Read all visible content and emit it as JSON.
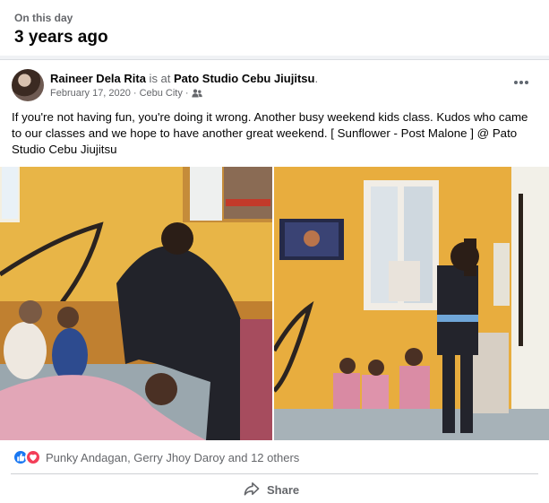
{
  "memory": {
    "label": "On this day",
    "title": "3 years ago"
  },
  "post": {
    "author": "Raineer Dela Rita",
    "is_at": " is at ",
    "place": "Pato Studio Cebu Jiujitsu",
    "place_suffix": ".",
    "date": "February 17, 2020",
    "location": "Cebu City",
    "audience_icon": "friends-icon",
    "more_icon": "more-options-icon",
    "text": "If you're not having fun, you're doing it wrong. Another busy weekend kids class. Kudos who came to our classes and we hope to have another great weekend. [ Sunflower - Post Malone ] @ Pato Studio Cebu Jiujitsu",
    "photos": [
      {
        "name": "photo-kids-class-sparring"
      },
      {
        "name": "photo-kids-class-stretching"
      }
    ]
  },
  "reactions": {
    "icons": [
      "like-icon",
      "love-icon"
    ],
    "summary": "Punky Andagan, Gerry Jhoy Daroy and 12 others"
  },
  "actions": {
    "share_label": "Share",
    "share_icon": "share-icon"
  },
  "colors": {
    "brand_blue": "#1877f2",
    "love_red": "#f33e58",
    "secondary_text": "#65676b"
  }
}
